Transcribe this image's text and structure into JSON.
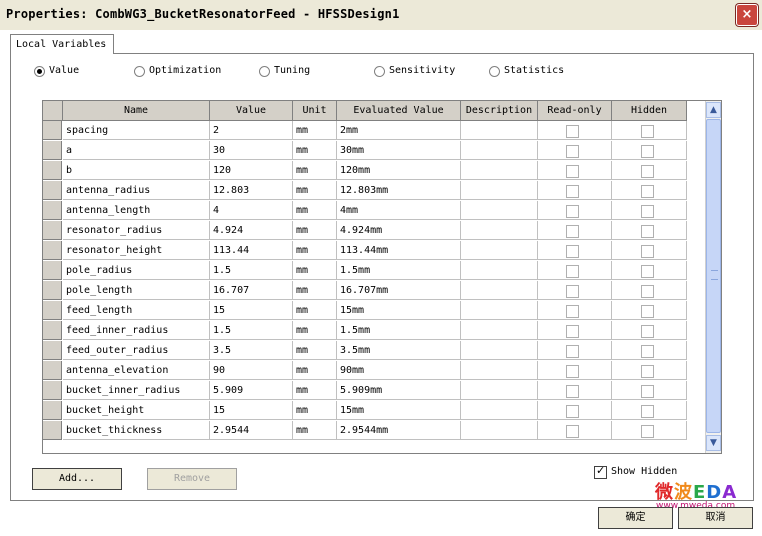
{
  "window": {
    "title": "Properties: CombWG3_BucketResonatorFeed - HFSSDesign1",
    "close_glyph": "×"
  },
  "tabs": [
    {
      "label": "Local Variables"
    }
  ],
  "view_options": [
    {
      "label": "Value",
      "selected": true
    },
    {
      "label": "Optimization",
      "selected": false
    },
    {
      "label": "Tuning",
      "selected": false
    },
    {
      "label": "Sensitivity",
      "selected": false
    },
    {
      "label": "Statistics",
      "selected": false
    }
  ],
  "table": {
    "columns": [
      "Name",
      "Value",
      "Unit",
      "Evaluated Value",
      "Description",
      "Read-only",
      "Hidden"
    ],
    "rows": [
      {
        "name": "spacing",
        "value": "2",
        "unit": "mm",
        "evaluated": "2mm",
        "description": "",
        "read_only": false,
        "hidden": false
      },
      {
        "name": "a",
        "value": "30",
        "unit": "mm",
        "evaluated": "30mm",
        "description": "",
        "read_only": false,
        "hidden": false
      },
      {
        "name": "b",
        "value": "120",
        "unit": "mm",
        "evaluated": "120mm",
        "description": "",
        "read_only": false,
        "hidden": false
      },
      {
        "name": "antenna_radius",
        "value": "12.803",
        "unit": "mm",
        "evaluated": "12.803mm",
        "description": "",
        "read_only": false,
        "hidden": false
      },
      {
        "name": "antenna_length",
        "value": "4",
        "unit": "mm",
        "evaluated": "4mm",
        "description": "",
        "read_only": false,
        "hidden": false
      },
      {
        "name": "resonator_radius",
        "value": "4.924",
        "unit": "mm",
        "evaluated": "4.924mm",
        "description": "",
        "read_only": false,
        "hidden": false
      },
      {
        "name": "resonator_height",
        "value": "113.44",
        "unit": "mm",
        "evaluated": "113.44mm",
        "description": "",
        "read_only": false,
        "hidden": false
      },
      {
        "name": "pole_radius",
        "value": "1.5",
        "unit": "mm",
        "evaluated": "1.5mm",
        "description": "",
        "read_only": false,
        "hidden": false
      },
      {
        "name": "pole_length",
        "value": "16.707",
        "unit": "mm",
        "evaluated": "16.707mm",
        "description": "",
        "read_only": false,
        "hidden": false
      },
      {
        "name": "feed_length",
        "value": "15",
        "unit": "mm",
        "evaluated": "15mm",
        "description": "",
        "read_only": false,
        "hidden": false
      },
      {
        "name": "feed_inner_radius",
        "value": "1.5",
        "unit": "mm",
        "evaluated": "1.5mm",
        "description": "",
        "read_only": false,
        "hidden": false
      },
      {
        "name": "feed_outer_radius",
        "value": "3.5",
        "unit": "mm",
        "evaluated": "3.5mm",
        "description": "",
        "read_only": false,
        "hidden": false
      },
      {
        "name": "antenna_elevation",
        "value": "90",
        "unit": "mm",
        "evaluated": "90mm",
        "description": "",
        "read_only": false,
        "hidden": false
      },
      {
        "name": "bucket_inner_radius",
        "value": "5.909",
        "unit": "mm",
        "evaluated": "5.909mm",
        "description": "",
        "read_only": false,
        "hidden": false
      },
      {
        "name": "bucket_height",
        "value": "15",
        "unit": "mm",
        "evaluated": "15mm",
        "description": "",
        "read_only": false,
        "hidden": false
      },
      {
        "name": "bucket_thickness",
        "value": "2.9544",
        "unit": "mm",
        "evaluated": "2.9544mm",
        "description": "",
        "read_only": false,
        "hidden": false
      }
    ]
  },
  "buttons": {
    "add": "Add...",
    "remove": "Remove",
    "ok": "确定",
    "cancel": "取消"
  },
  "show_hidden": {
    "label": "Show Hidden",
    "checked": true
  },
  "watermark": {
    "text": "微波EDA",
    "url": "www.mweda.com"
  }
}
